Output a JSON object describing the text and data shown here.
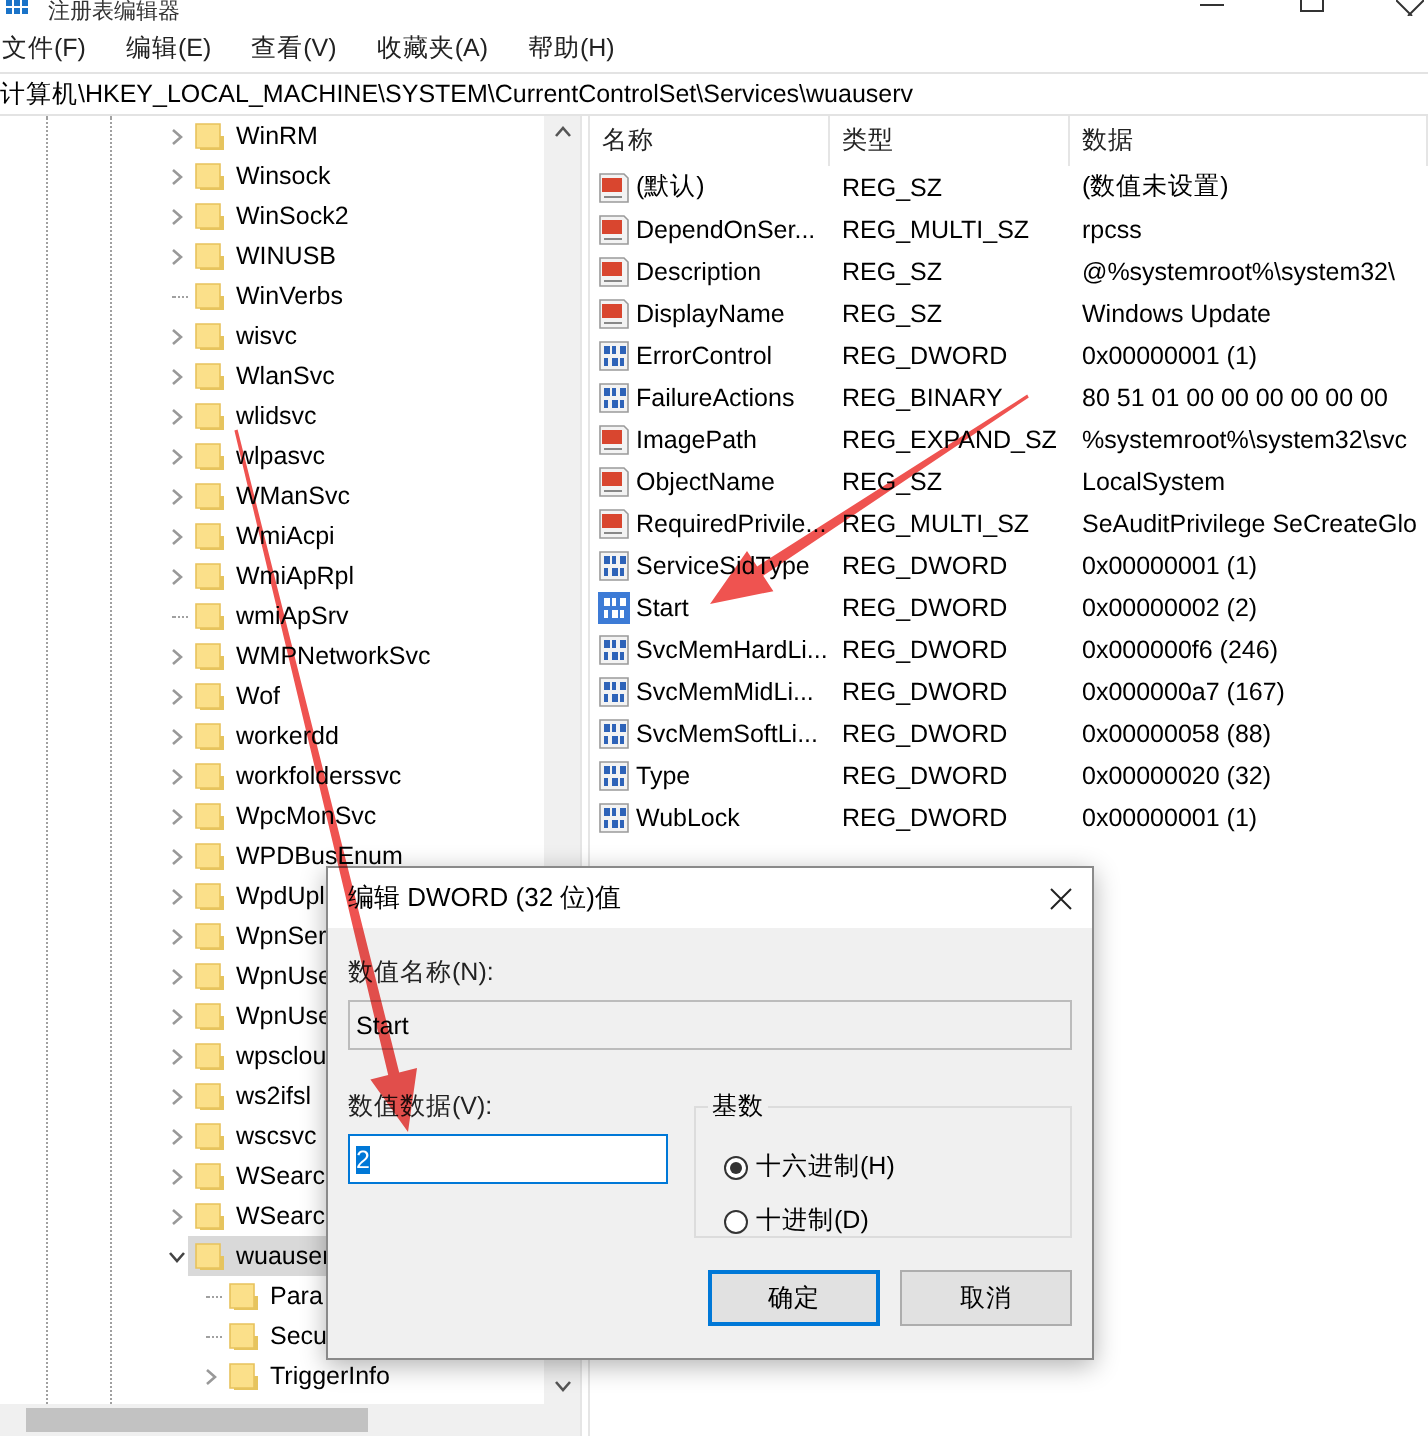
{
  "window": {
    "title": "注册表编辑器"
  },
  "menu": [
    {
      "label": "文件(F)"
    },
    {
      "label": "编辑(E)"
    },
    {
      "label": "查看(V)"
    },
    {
      "label": "收藏夹(A)"
    },
    {
      "label": "帮助(H)"
    }
  ],
  "address": "计算机\\HKEY_LOCAL_MACHINE\\SYSTEM\\CurrentControlSet\\Services\\wuauserv",
  "tree": {
    "items": [
      {
        "label": "WinRM",
        "expandable": true,
        "expanded": false,
        "selected": false
      },
      {
        "label": "Winsock",
        "expandable": true,
        "expanded": false,
        "selected": false
      },
      {
        "label": "WinSock2",
        "expandable": true,
        "expanded": false,
        "selected": false
      },
      {
        "label": "WINUSB",
        "expandable": true,
        "expanded": false,
        "selected": false
      },
      {
        "label": "WinVerbs",
        "expandable": false,
        "selected": false
      },
      {
        "label": "wisvc",
        "expandable": true,
        "expanded": false,
        "selected": false
      },
      {
        "label": "WlanSvc",
        "expandable": true,
        "expanded": false,
        "selected": false
      },
      {
        "label": "wlidsvc",
        "expandable": true,
        "expanded": false,
        "selected": false
      },
      {
        "label": "wlpasvc",
        "expandable": true,
        "expanded": false,
        "selected": false
      },
      {
        "label": "WManSvc",
        "expandable": true,
        "expanded": false,
        "selected": false
      },
      {
        "label": "WmiAcpi",
        "expandable": true,
        "expanded": false,
        "selected": false
      },
      {
        "label": "WmiApRpl",
        "expandable": true,
        "expanded": false,
        "selected": false
      },
      {
        "label": "wmiApSrv",
        "expandable": false,
        "selected": false
      },
      {
        "label": "WMPNetworkSvc",
        "expandable": true,
        "expanded": false,
        "selected": false
      },
      {
        "label": "Wof",
        "expandable": true,
        "expanded": false,
        "selected": false
      },
      {
        "label": "workerdd",
        "expandable": true,
        "expanded": false,
        "selected": false
      },
      {
        "label": "workfolderssvc",
        "expandable": true,
        "expanded": false,
        "selected": false
      },
      {
        "label": "WpcMonSvc",
        "expandable": true,
        "expanded": false,
        "selected": false
      },
      {
        "label": "WPDBusEnum",
        "expandable": true,
        "expanded": false,
        "selected": false
      },
      {
        "label": "WpdUpl",
        "expandable": true,
        "expanded": false,
        "selected": false
      },
      {
        "label": "WpnSer",
        "expandable": true,
        "expanded": false,
        "selected": false
      },
      {
        "label": "WpnUse",
        "expandable": true,
        "expanded": false,
        "selected": false
      },
      {
        "label": "WpnUse",
        "expandable": true,
        "expanded": false,
        "selected": false
      },
      {
        "label": "wpsclou",
        "expandable": true,
        "expanded": false,
        "selected": false
      },
      {
        "label": "ws2ifsl",
        "expandable": true,
        "expanded": false,
        "selected": false
      },
      {
        "label": "wscsvc",
        "expandable": true,
        "expanded": false,
        "selected": false
      },
      {
        "label": "WSearc",
        "expandable": true,
        "expanded": false,
        "selected": false
      },
      {
        "label": "WSearc",
        "expandable": true,
        "expanded": false,
        "selected": false
      },
      {
        "label": "wuauser",
        "expandable": true,
        "expanded": true,
        "selected": true,
        "children": [
          {
            "label": "Para",
            "expandable": false,
            "selected": false
          },
          {
            "label": "Secu",
            "expandable": false,
            "selected": false
          },
          {
            "label": "TriggerInfo",
            "expandable": true,
            "expanded": false,
            "selected": false
          }
        ]
      }
    ]
  },
  "values": {
    "columns": [
      "名称",
      "类型",
      "数据"
    ],
    "rows": [
      {
        "kind": "string",
        "name": "(默认)",
        "type": "REG_SZ",
        "data": "(数值未设置)",
        "selected": false
      },
      {
        "kind": "string",
        "name": "DependOnSer...",
        "type": "REG_MULTI_SZ",
        "data": "rpcss",
        "selected": false
      },
      {
        "kind": "string",
        "name": "Description",
        "type": "REG_SZ",
        "data": "@%systemroot%\\system32\\",
        "selected": false
      },
      {
        "kind": "string",
        "name": "DisplayName",
        "type": "REG_SZ",
        "data": "Windows Update",
        "selected": false
      },
      {
        "kind": "binary",
        "name": "ErrorControl",
        "type": "REG_DWORD",
        "data": "0x00000001 (1)",
        "selected": false
      },
      {
        "kind": "binary",
        "name": "FailureActions",
        "type": "REG_BINARY",
        "data": "80 51 01 00 00 00 00 00 00",
        "selected": false
      },
      {
        "kind": "string",
        "name": "ImagePath",
        "type": "REG_EXPAND_SZ",
        "data": "%systemroot%\\system32\\svc",
        "selected": false
      },
      {
        "kind": "string",
        "name": "ObjectName",
        "type": "REG_SZ",
        "data": "LocalSystem",
        "selected": false
      },
      {
        "kind": "string",
        "name": "RequiredPrivile...",
        "type": "REG_MULTI_SZ",
        "data": "SeAuditPrivilege SeCreateGlo",
        "selected": false
      },
      {
        "kind": "binary",
        "name": "ServiceSidType",
        "type": "REG_DWORD",
        "data": "0x00000001 (1)",
        "selected": false
      },
      {
        "kind": "binary",
        "name": "Start",
        "type": "REG_DWORD",
        "data": "0x00000002 (2)",
        "selected": true
      },
      {
        "kind": "binary",
        "name": "SvcMemHardLi...",
        "type": "REG_DWORD",
        "data": "0x000000f6 (246)",
        "selected": false
      },
      {
        "kind": "binary",
        "name": "SvcMemMidLi...",
        "type": "REG_DWORD",
        "data": "0x000000a7 (167)",
        "selected": false
      },
      {
        "kind": "binary",
        "name": "SvcMemSoftLi...",
        "type": "REG_DWORD",
        "data": "0x00000058 (88)",
        "selected": false
      },
      {
        "kind": "binary",
        "name": "Type",
        "type": "REG_DWORD",
        "data": "0x00000020 (32)",
        "selected": false
      },
      {
        "kind": "binary",
        "name": "WubLock",
        "type": "REG_DWORD",
        "data": "0x00000001 (1)",
        "selected": false
      }
    ]
  },
  "dialog": {
    "title": "编辑 DWORD (32 位)值",
    "name_label": "数值名称(N):",
    "name_value": "Start",
    "data_label": "数值数据(V):",
    "data_value": "2",
    "base": {
      "title": "基数",
      "options": [
        {
          "label": "十六进制(H)",
          "selected": true
        },
        {
          "label": "十进制(D)",
          "selected": false
        }
      ]
    },
    "buttons": [
      {
        "label": "确定",
        "default": true
      },
      {
        "label": "取消",
        "default": false
      }
    ]
  }
}
